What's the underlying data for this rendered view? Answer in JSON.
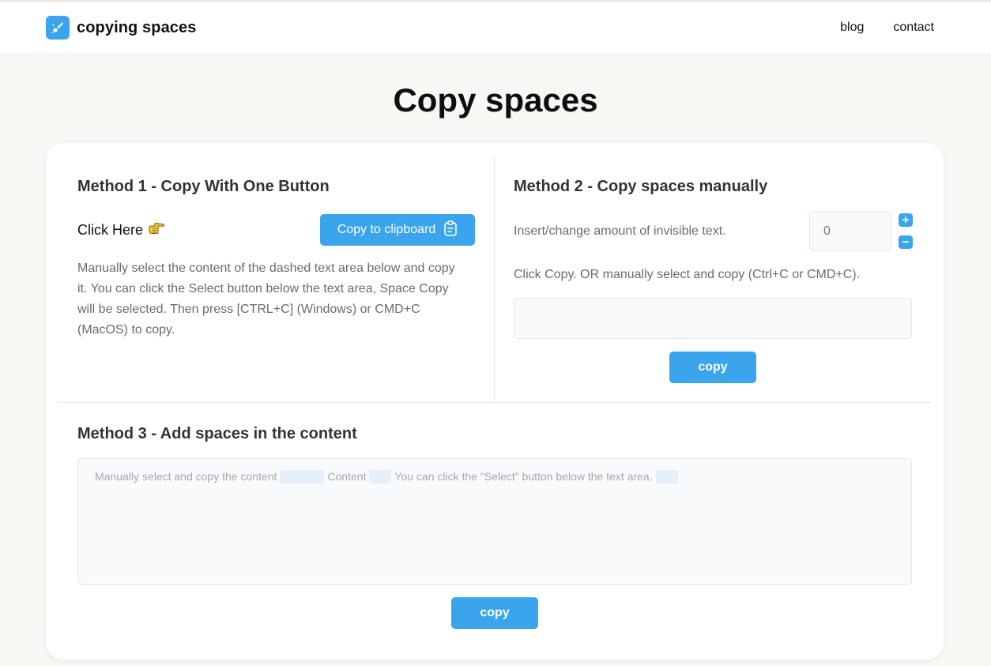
{
  "header": {
    "brand_name": "copying spaces",
    "nav": [
      {
        "label": "blog"
      },
      {
        "label": "contact"
      }
    ]
  },
  "page": {
    "title": "Copy spaces"
  },
  "method1": {
    "title": "Method 1 - Copy With One Button",
    "click_here": "Click Here",
    "copy_button": "Copy to clipboard",
    "description": "Manually select the content of the dashed text area below and copy it. You can click the Select button below the text area, Space Copy will be selected. Then press [CTRL+C] (Windows) or CMD+C (MacOS) to copy."
  },
  "method2": {
    "title": "Method 2 - Copy spaces manually",
    "amount_label": "Insert/change amount of invisible text.",
    "amount_placeholder": "0",
    "increment": "+",
    "decrement": "−",
    "hint": "Click Copy. OR manually select and copy (Ctrl+C or CMD+C).",
    "copy_button": "copy"
  },
  "method3": {
    "title": "Method 3 - Add spaces in the content",
    "segments": [
      "Manually select and copy the content",
      "Content",
      "You can click the \"Select\" button below the text area."
    ],
    "copy_button": "copy"
  },
  "colors": {
    "accent": "#3aa4ec",
    "page_bg": "#f8f7f4"
  },
  "icons": {
    "logo": "brush-sparkle-icon",
    "click_here": "pointing-hand-icon",
    "clipboard": "clipboard-icon"
  }
}
